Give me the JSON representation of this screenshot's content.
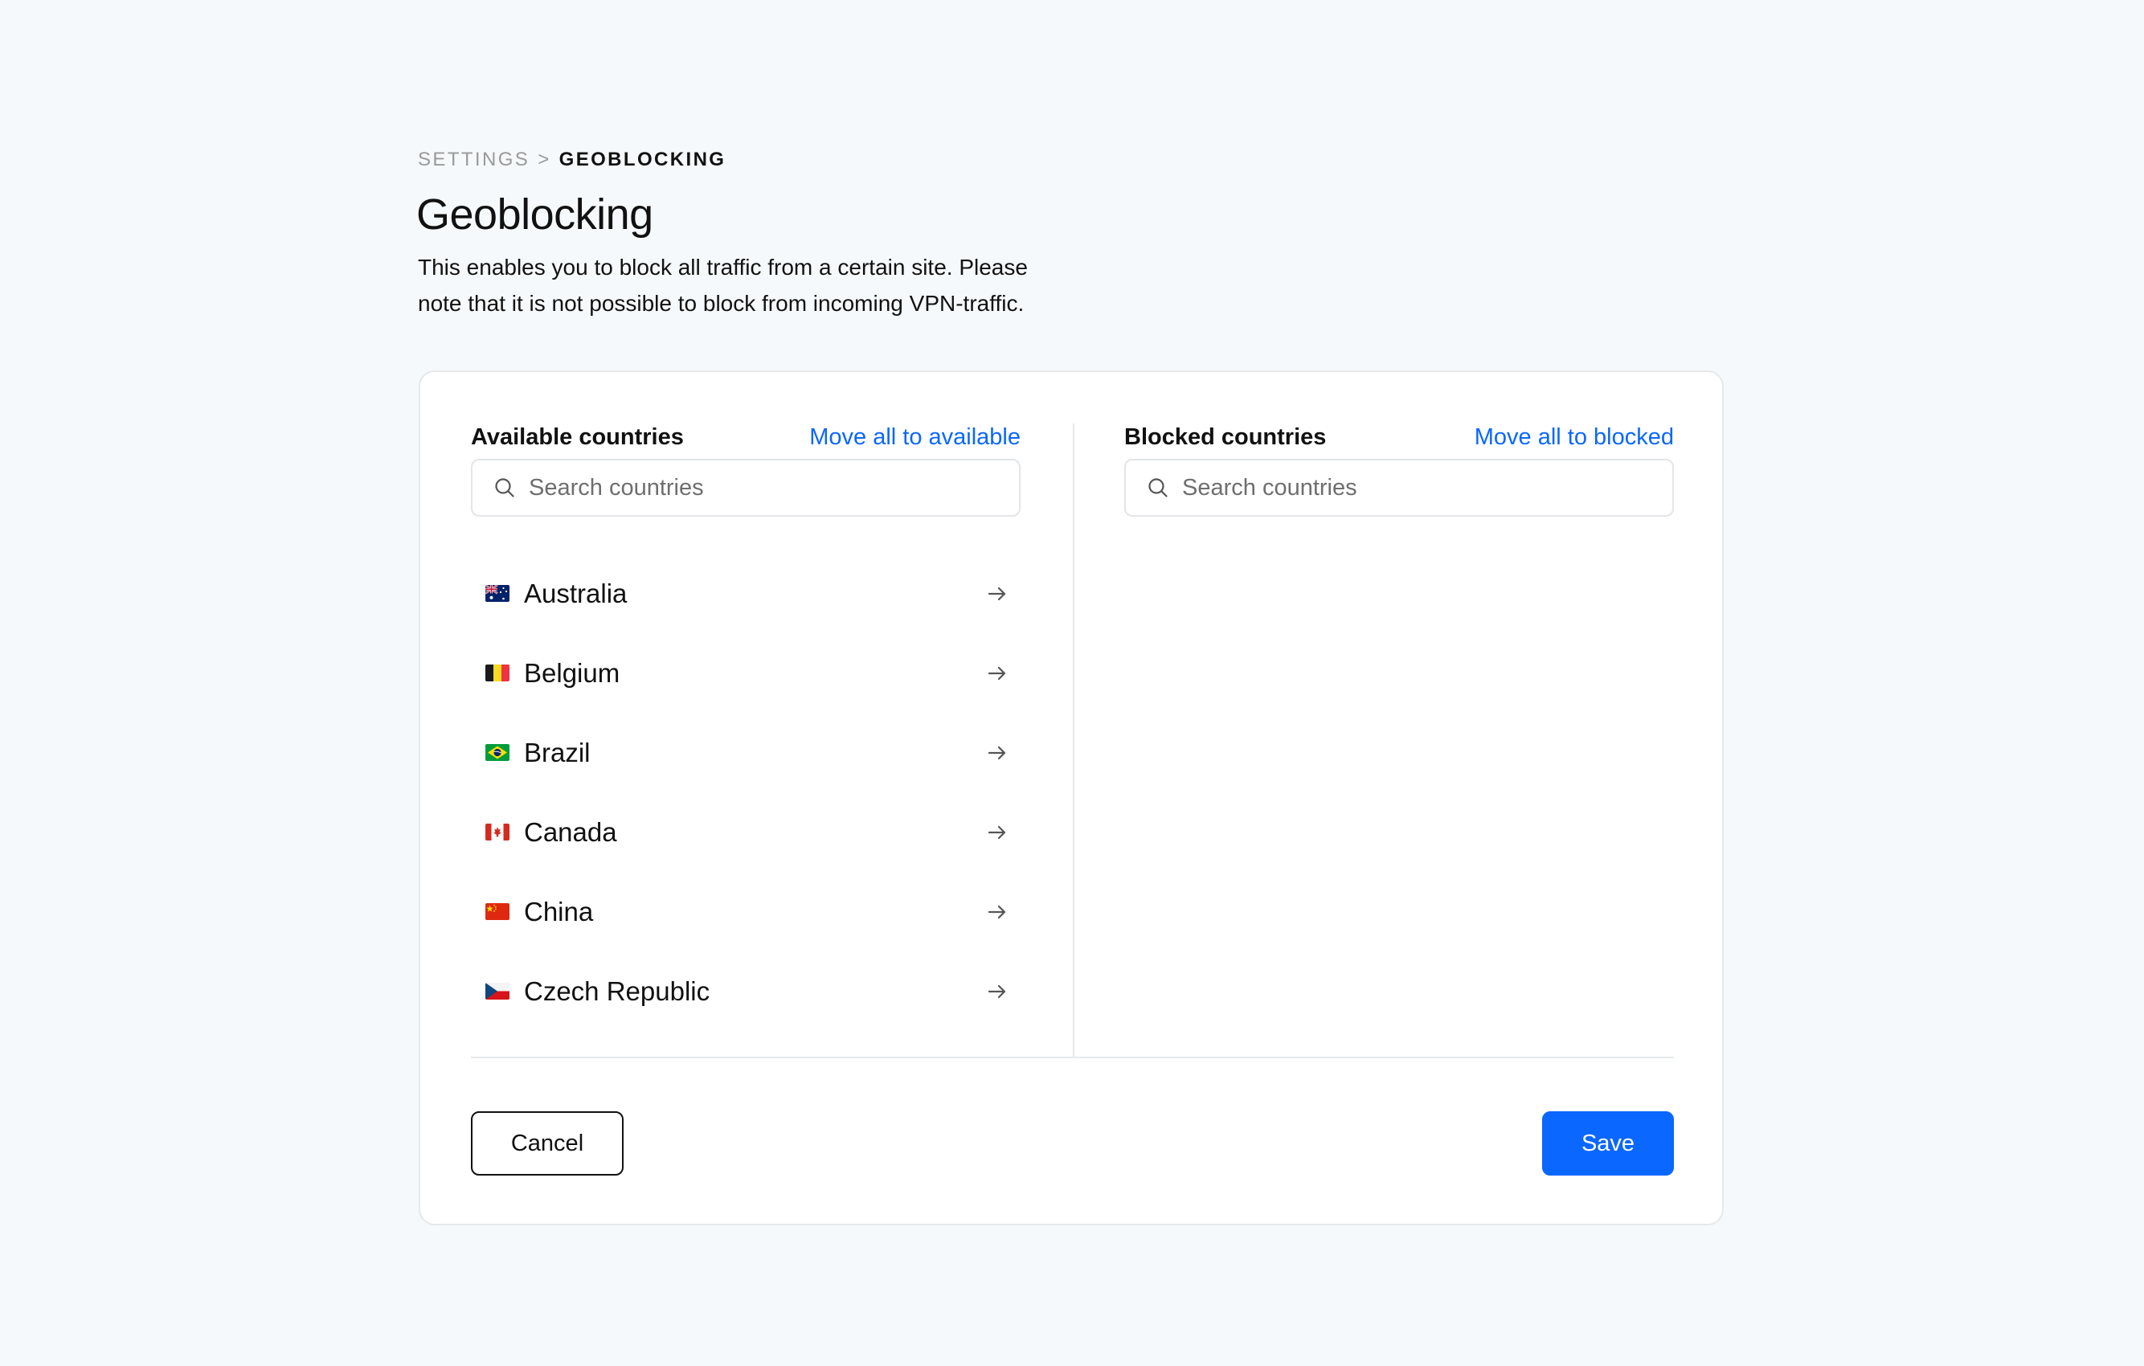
{
  "breadcrumb": {
    "parent": "SETTINGS",
    "separator": ">",
    "current": "GEOBLOCKING"
  },
  "page": {
    "title": "Geoblocking",
    "description": "This enables you to block all traffic from a certain site. Please note that it is not possible to block from incoming VPN-traffic."
  },
  "available": {
    "title": "Available countries",
    "move_all_label": "Move all to available",
    "search_placeholder": "Search countries",
    "countries": [
      {
        "name": "Australia",
        "flag_icon": "australia-flag-icon"
      },
      {
        "name": "Belgium",
        "flag_icon": "belgium-flag-icon"
      },
      {
        "name": "Brazil",
        "flag_icon": "brazil-flag-icon"
      },
      {
        "name": "Canada",
        "flag_icon": "canada-flag-icon"
      },
      {
        "name": "China",
        "flag_icon": "china-flag-icon"
      },
      {
        "name": "Czech Republic",
        "flag_icon": "czech-republic-flag-icon"
      }
    ]
  },
  "blocked": {
    "title": "Blocked countries",
    "move_all_label": "Move all to blocked",
    "search_placeholder": "Search countries",
    "countries": []
  },
  "actions": {
    "cancel_label": "Cancel",
    "save_label": "Save"
  },
  "colors": {
    "accent": "#0a67ff",
    "background": "#f6f9fb",
    "card": "#ffffff",
    "border": "#e6e8eb"
  }
}
